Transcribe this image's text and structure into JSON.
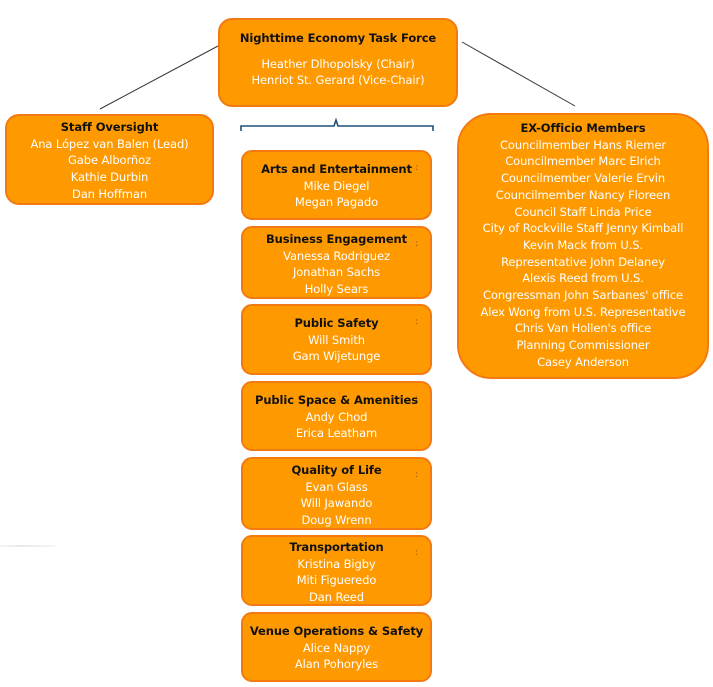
{
  "top": {
    "title": "Nighttime Economy Task Force",
    "members": [
      "Heather Dlhopolsky (Chair)",
      "Henriot St. Gerard (Vice-Chair)"
    ]
  },
  "staff_oversight": {
    "title": "Staff Oversight",
    "members": [
      "Ana López van Balen (Lead)",
      "Gabe Alborñoz",
      "Kathie Durbin",
      "Dan Hoffman"
    ]
  },
  "ex_officio": {
    "title": "EX-Officio Members",
    "members": [
      "Councilmember Hans Riemer",
      "Councilmember Marc Elrich",
      "Councilmember Valerie Ervin",
      "Councilmember Nancy Floreen",
      "Council Staff Linda Price",
      "City of Rockville Staff Jenny Kimball",
      "Kevin Mack from U.S.",
      "Representative John Delaney",
      "Alexis Reed from U.S.",
      "Congressman John Sarbanes' office",
      "Alex Wong from U.S. Representative",
      "Chris Van Hollen's office",
      "Planning Commissioner",
      "Casey Anderson"
    ]
  },
  "committees": [
    {
      "title": "Arts and Entertainment",
      "members": [
        "Mike Diegel",
        "Megan Pagado"
      ]
    },
    {
      "title": "Business Engagement",
      "members": [
        "Vanessa Rodriguez",
        "Jonathan Sachs",
        "Holly Sears"
      ]
    },
    {
      "title": "Public Safety",
      "members": [
        "Will Smith",
        "Gam Wijetunge"
      ]
    },
    {
      "title": "Public Space & Amenities",
      "members": [
        "Andy Chod",
        "Erica Leatham"
      ]
    },
    {
      "title": "Quality of Life",
      "members": [
        "Evan Glass",
        "Will Jawando",
        "Doug Wrenn"
      ]
    },
    {
      "title": "Transportation",
      "members": [
        "Kristina Bigby",
        "Miti Figueredo",
        "Dan Reed"
      ]
    },
    {
      "title": "Venue Operations & Safety",
      "members": [
        "Alice Nappy",
        "Alan Pohoryles"
      ]
    }
  ],
  "colors": {
    "box_fill": "#ff9900",
    "box_border": "#f27a10",
    "title_text": "#111111",
    "member_text": "#ffffff",
    "connector": "#333333",
    "bracket": "#1f4e79"
  }
}
